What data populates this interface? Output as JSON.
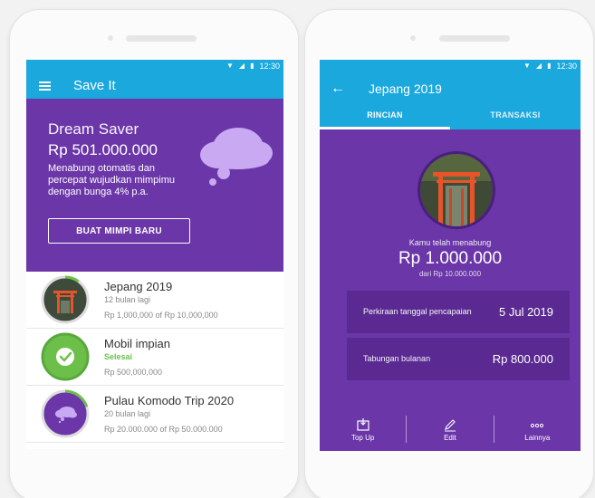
{
  "status": {
    "time": "12:30"
  },
  "left": {
    "appbar": {
      "title": "Save It"
    },
    "hero": {
      "title": "Dream Saver",
      "amount": "Rp 501.000.000",
      "description": "Menabung otomatis dan percepat wujudkan mimpimu dengan bunga 4% p.a.",
      "button": "BUAT MIMPI BARU"
    },
    "goals": [
      {
        "name": "Jepang 2019",
        "sub": "12 bulan lagi",
        "amount": "Rp 1,000,000 of Rp 10,000,000",
        "progress": 0.1
      },
      {
        "name": "Mobil impian",
        "sub": "Selesai",
        "amount": "Rp 500,000,000",
        "progress": 1.0
      },
      {
        "name": "Pulau Komodo Trip 2020",
        "sub": "20 bulan lagi",
        "amount": "Rp 20.000.000 of Rp 50.000.000",
        "progress": 0.4
      }
    ]
  },
  "right": {
    "appbar": {
      "title": "Jepang 2019"
    },
    "tabs": [
      "RINCIAN",
      "TRANSAKSI"
    ],
    "saved_label": "Kamu telah menabung",
    "saved_amount": "Rp 1.000.000",
    "saved_of": "dari Rp 10.000.000",
    "estimate": {
      "label": "Perkiraan tanggal pencapaian",
      "value": "5 Jul 2019"
    },
    "monthly": {
      "label": "Tabungan bulanan",
      "value": "Rp 800.000"
    },
    "actions": [
      "Top Up",
      "Edit",
      "Lainnya"
    ]
  },
  "colors": {
    "primary_blue": "#1aa8dd",
    "purple": "#6a36a8",
    "dark_purple": "#5a2a92",
    "success_green": "#6cc04a"
  }
}
